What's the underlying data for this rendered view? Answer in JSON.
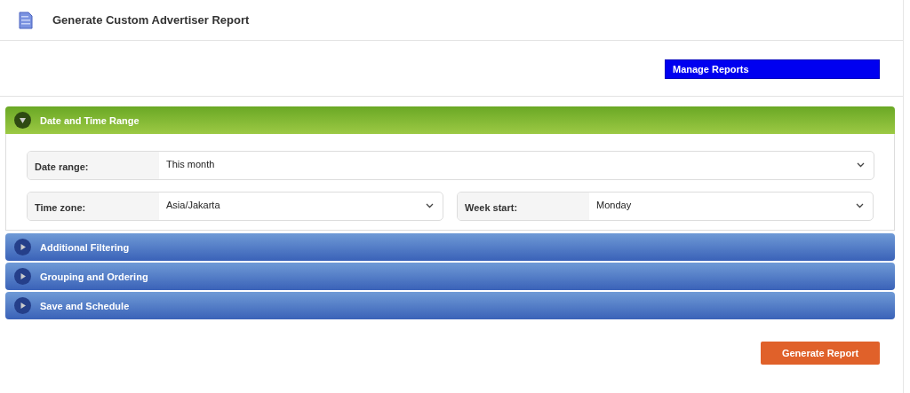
{
  "page": {
    "title": "Generate Custom Advertiser Report"
  },
  "manage_button": "Manage Reports",
  "sections": [
    {
      "title": "Date and Time Range",
      "expanded": true,
      "rows": [
        [
          {
            "label": "Date range:",
            "value": "This month"
          }
        ],
        [
          {
            "label": "Time zone:",
            "value": "Asia/Jakarta"
          },
          {
            "label": "Week start:",
            "value": "Monday"
          }
        ]
      ]
    },
    {
      "title": "Additional Filtering",
      "expanded": false
    },
    {
      "title": "Grouping and Ordering",
      "expanded": false
    },
    {
      "title": "Save and Schedule",
      "expanded": false
    }
  ],
  "generate_button": "Generate Report"
}
